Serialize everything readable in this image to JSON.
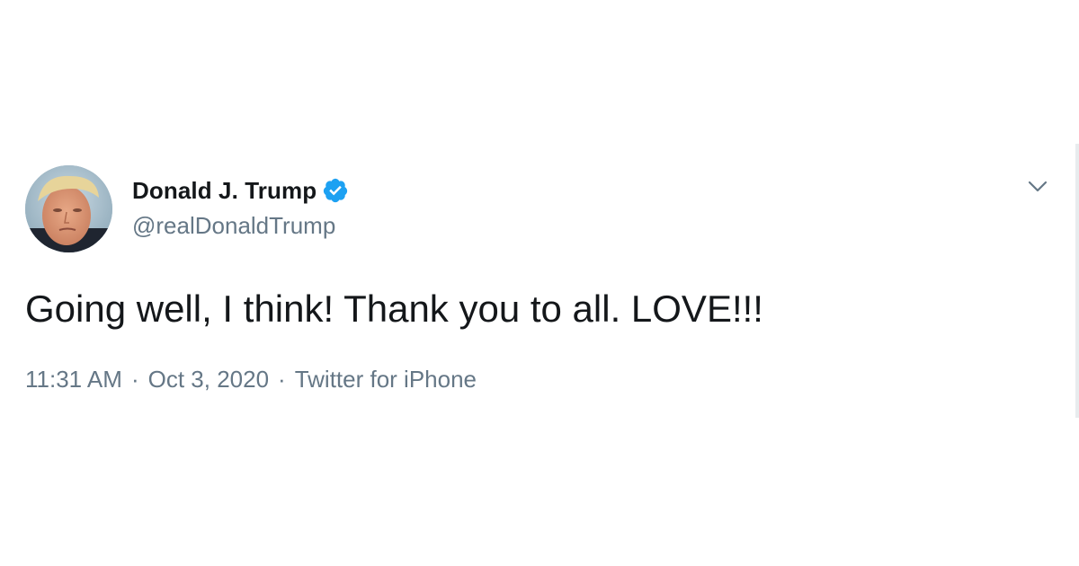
{
  "tweet": {
    "author": {
      "display_name": "Donald J. Trump",
      "handle": "@realDonaldTrump",
      "verified_icon": "verified-badge-icon",
      "verified_color": "#1da1f2",
      "avatar": "profile-avatar"
    },
    "text": "Going well, I think! Thank you to all. LOVE!!!",
    "meta": {
      "time": "11:31 AM",
      "separator": "·",
      "date": "Oct 3, 2020",
      "source": "Twitter for iPhone"
    },
    "menu_icon": "chevron-down-icon"
  },
  "colors": {
    "text_primary": "#14171a",
    "text_secondary": "#657786",
    "accent": "#1da1f2",
    "background": "#ffffff"
  }
}
